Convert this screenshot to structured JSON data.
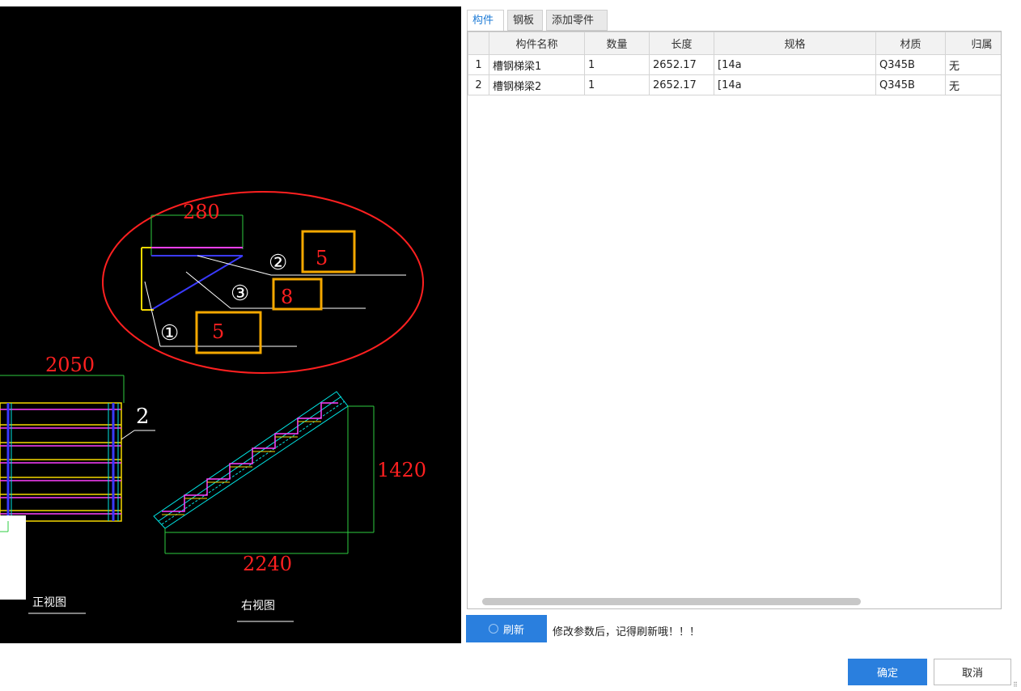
{
  "drawing": {
    "detail": {
      "dim_top": "280",
      "callouts": [
        {
          "marker": "②",
          "value": "5"
        },
        {
          "marker": "③",
          "value": "8"
        },
        {
          "marker": "①",
          "value": "5"
        }
      ]
    },
    "front": {
      "dim_width": "2050",
      "part_label": "2",
      "title": "正视图"
    },
    "side": {
      "dim_height": "1420",
      "dim_width": "2240",
      "title": "右视图"
    },
    "colors": {
      "dimension": "#ff2020",
      "highlight_box": "#f5a800",
      "ellipse": "#ff2020"
    }
  },
  "tabs": [
    {
      "label": "构件",
      "active": true
    },
    {
      "label": "钢板",
      "active": false
    },
    {
      "label": "添加零件",
      "active": false
    }
  ],
  "table": {
    "columns": [
      "构件名称",
      "数量",
      "长度",
      "规格",
      "材质",
      "归属"
    ],
    "rows": [
      {
        "no": "1",
        "name": "槽钢梯梁1",
        "qty": "1",
        "length": "2652.17",
        "spec": "[14a",
        "material": "Q345B",
        "owner": "无"
      },
      {
        "no": "2",
        "name": "槽钢梯梁2",
        "qty": "1",
        "length": "2652.17",
        "spec": "[14a",
        "material": "Q345B",
        "owner": "无"
      }
    ]
  },
  "refresh_button": "刷新",
  "hint": "修改参数后，记得刷新哦！！！",
  "ok_button": "确定",
  "cancel_button": "取消"
}
